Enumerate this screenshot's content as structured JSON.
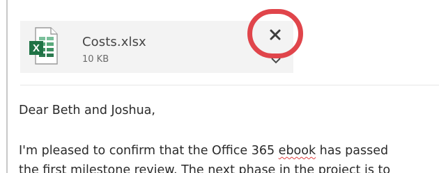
{
  "attachment": {
    "file_name": "Costs.xlsx",
    "file_size": "10 KB",
    "icon": "excel-file-icon",
    "icon_letter": "X"
  },
  "controls": {
    "remove_icon": "close-icon",
    "menu_icon": "chevron-down-icon",
    "highlight_color": "#e0454b"
  },
  "message": {
    "greeting": "Dear Beth and Joshua,",
    "line1_before": "I'm pleased to confirm that the Office 365 ",
    "line1_misspelled": "ebook",
    "line1_after": " has passed",
    "line2": "the first milestone review. The next phase in the project is to"
  }
}
